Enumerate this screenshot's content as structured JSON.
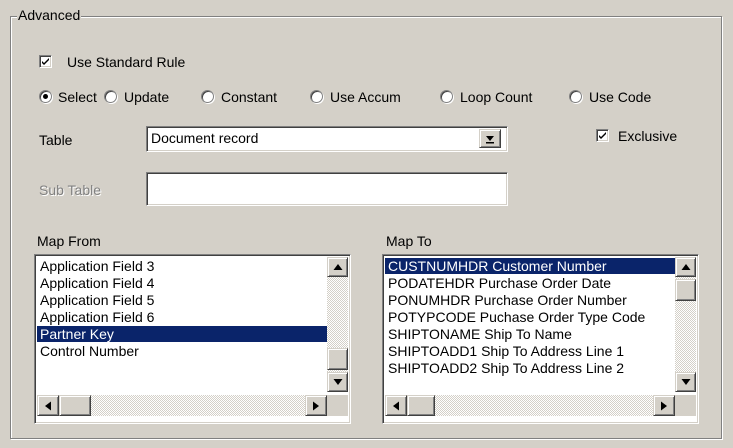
{
  "group": {
    "title": "Advanced"
  },
  "use_standard_rule": {
    "label": "Use Standard Rule",
    "checked": true
  },
  "radios": [
    {
      "label": "Select",
      "selected": true
    },
    {
      "label": "Update",
      "selected": false
    },
    {
      "label": "Constant",
      "selected": false
    },
    {
      "label": "Use Accum",
      "selected": false
    },
    {
      "label": "Loop Count",
      "selected": false
    },
    {
      "label": "Use Code",
      "selected": false
    }
  ],
  "table": {
    "label": "Table",
    "value": "Document record"
  },
  "exclusive": {
    "label": "Exclusive",
    "checked": true
  },
  "sub_table": {
    "label": "Sub Table",
    "value": ""
  },
  "map_from": {
    "label": "Map From",
    "items": [
      "Application Field 3",
      "Application Field 4",
      "Application Field 5",
      "Application Field 6",
      "Partner Key",
      "Control Number"
    ],
    "selected_index": 4
  },
  "map_to": {
    "label": "Map To",
    "items": [
      "CUSTNUMHDR Customer Number",
      "PODATEHDR Purchase Order Date",
      "PONUMHDR Purchase Order Number",
      "POTYPCODE Puchase Order Type Code",
      "SHIPTONAME Ship To Name",
      "SHIPTOADD1 Ship To Address Line 1",
      "SHIPTOADD2 Ship To Address Line 2"
    ],
    "selected_index": 0
  },
  "colors": {
    "selection": "#0a246a",
    "face": "#d4d0c8"
  }
}
